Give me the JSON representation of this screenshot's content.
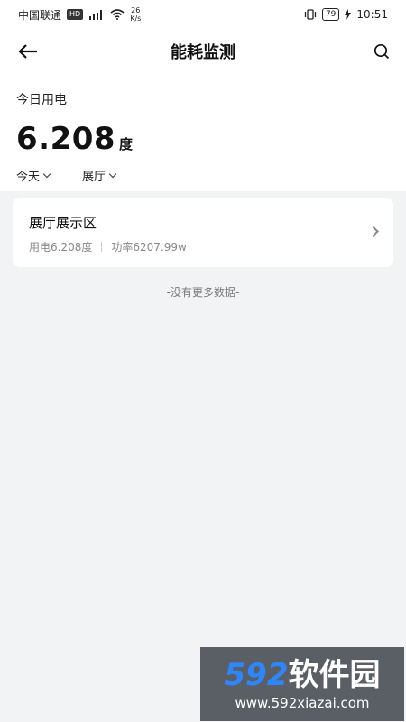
{
  "status_bar": {
    "carrier": "中国联通",
    "hd": "HD",
    "network_speed_value": "26",
    "network_speed_unit": "K/s",
    "battery": "79",
    "time": "10:51"
  },
  "nav": {
    "title": "能耗监测",
    "back_icon": "arrow-left-icon",
    "search_icon": "search-icon"
  },
  "summary": {
    "label": "今日用电",
    "value": "6.208",
    "unit": "度"
  },
  "filters": [
    {
      "label": "今天"
    },
    {
      "label": "展厅"
    }
  ],
  "list": [
    {
      "title": "展厅展示区",
      "usage": "用电6.208度",
      "power": "功率6207.99w"
    }
  ],
  "footer_text": "-没有更多数据-",
  "watermark": {
    "brand_num": "592",
    "brand_text": "软件园",
    "url": "www.592xiazai.com"
  }
}
